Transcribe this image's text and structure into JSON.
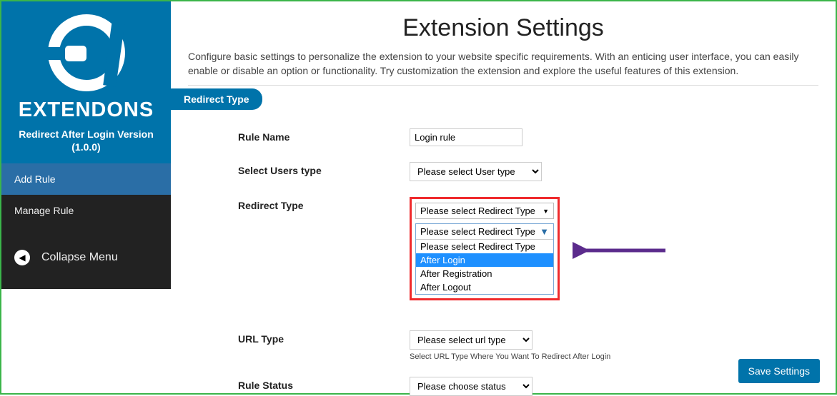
{
  "brand": {
    "name": "EXTENDONS",
    "subtitle": "Redirect After Login Version\n(1.0.0)"
  },
  "sidebar": {
    "items": [
      {
        "label": "Add Rule",
        "active": true
      },
      {
        "label": "Manage Rule",
        "active": false
      }
    ],
    "collapse": "Collapse Menu"
  },
  "page": {
    "title": "Extension Settings",
    "description": "Configure basic settings to personalize the extension to your website specific requirements. With an enticing user interface, you can easily enable or disable an option or functionality. Try customization the extension and explore the useful features of this extension."
  },
  "tab": "Redirect Type",
  "form": {
    "rule_name": {
      "label": "Rule Name",
      "value": "Login rule"
    },
    "users_type": {
      "label": "Select Users type",
      "placeholder": "Please select User type"
    },
    "redirect_type": {
      "label": "Redirect Type",
      "placeholder": "Please select Redirect Type",
      "options": [
        "Please select Redirect Type",
        "After Login",
        "After Registration",
        "After Logout"
      ],
      "highlighted": "After Login"
    },
    "url_type": {
      "label": "URL Type",
      "placeholder": "Please select url type",
      "help": "Select URL Type Where You Want To Redirect After Login"
    },
    "rule_status": {
      "label": "Rule Status",
      "placeholder": "Please choose status"
    }
  },
  "buttons": {
    "save": "Save Settings"
  }
}
